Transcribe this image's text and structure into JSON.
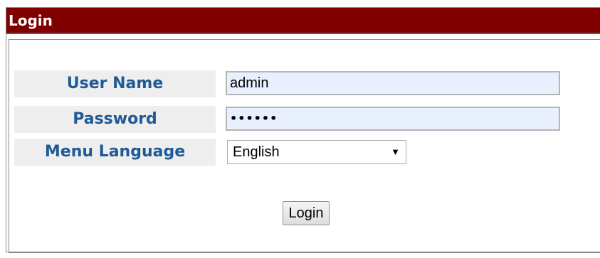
{
  "header": {
    "title": "Login"
  },
  "form": {
    "username_label": "User Name",
    "username_value": "admin",
    "password_label": "Password",
    "password_value": "••••••",
    "language_label": "Menu Language",
    "language_selected": "English",
    "login_button": "Login"
  },
  "colors": {
    "titlebar_bg": "#800000",
    "label_text": "#1f5a96",
    "label_bg": "#eeeeee",
    "autofill_bg": "#e8f0fe"
  },
  "icons": {
    "dropdown": "chevron-down-icon"
  }
}
